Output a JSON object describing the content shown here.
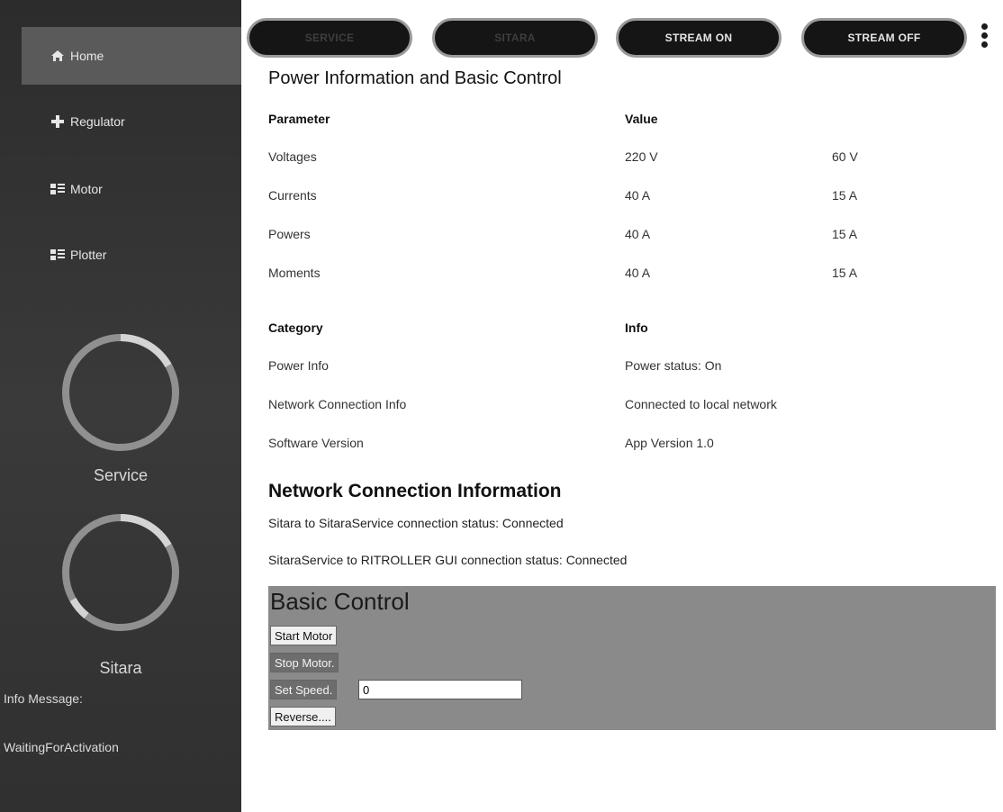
{
  "sidebar": {
    "items": [
      {
        "label": "Home",
        "icon": "home-icon"
      },
      {
        "label": "Regulator",
        "icon": "plus-icon"
      },
      {
        "label": "Motor",
        "icon": "list-icon"
      },
      {
        "label": "Plotter",
        "icon": "list-icon"
      }
    ],
    "gauges": [
      {
        "label": "Service"
      },
      {
        "label": "Sitara"
      }
    ],
    "info_message_label": "Info Message:",
    "info_message_value": "WaitingForActivation"
  },
  "topbar": {
    "buttons": [
      {
        "label": "SERVICE",
        "state": "disabled"
      },
      {
        "label": "SITARA",
        "state": "disabled"
      },
      {
        "label": "STREAM ON",
        "state": "enabled"
      },
      {
        "label": "STREAM OFF",
        "state": "enabled"
      }
    ]
  },
  "power": {
    "title": "Power Information and Basic Control",
    "headers": {
      "parameter": "Parameter",
      "value": "Value"
    },
    "rows": [
      {
        "name": "Voltages",
        "v1": "220 V",
        "v2": "60 V"
      },
      {
        "name": "Currents",
        "v1": "40 A",
        "v2": "15 A"
      },
      {
        "name": "Powers",
        "v1": "40 A",
        "v2": "15 A"
      },
      {
        "name": "Moments",
        "v1": "40 A",
        "v2": "15 A"
      }
    ]
  },
  "info_table": {
    "headers": {
      "category": "Category",
      "info": "Info"
    },
    "rows": [
      {
        "category": "Power Info",
        "info": "Power status: On"
      },
      {
        "category": "Network Connection Info",
        "info": "Connected to local network"
      },
      {
        "category": "Software Version",
        "info": "App Version 1.0"
      }
    ]
  },
  "network": {
    "title": "Network Connection Information",
    "lines": [
      "Sitara to SitaraService connection status: Connected",
      "SitaraService to RITROLLER GUI connection status: Connected"
    ]
  },
  "control": {
    "title": "Basic Control",
    "start_label": "Start Motor",
    "stop_label": "Stop Motor.",
    "set_speed_label": "Set Speed.",
    "speed_value": "0",
    "reverse_label": "Reverse...."
  },
  "colors": {
    "sidebar_bg": "#333333",
    "sidebar_active": "#5a5a5a",
    "pill_bg": "#151515",
    "control_bg": "#8a8a8a"
  }
}
